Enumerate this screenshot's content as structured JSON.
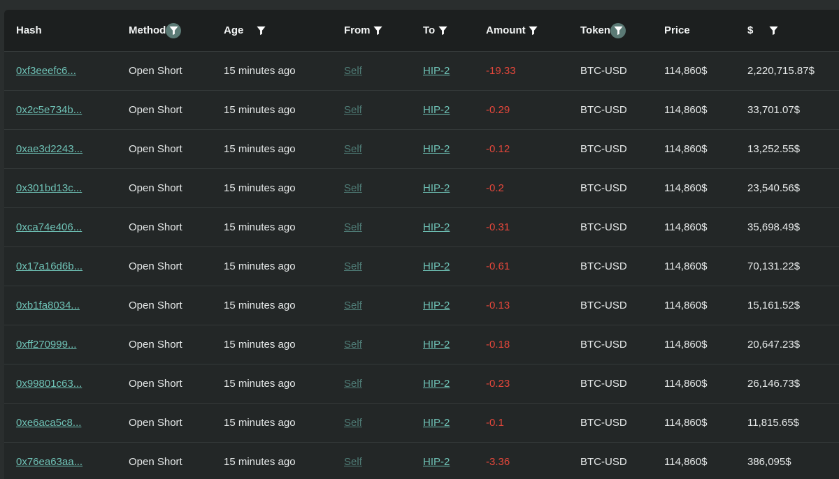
{
  "table": {
    "headers": {
      "hash": "Hash",
      "method": "Method",
      "age": "Age",
      "from": "From",
      "to": "To",
      "amount": "Amount",
      "token": "Token",
      "price": "Price",
      "usd": "$"
    },
    "rows": [
      {
        "hash": "0xf3eeefc6...",
        "method": "Open Short",
        "age": "15 minutes ago",
        "from": "Self",
        "to": "HIP-2",
        "amount": "-19.33",
        "token": "BTC-USD",
        "price": "114,860$",
        "usd": "2,220,715.87$"
      },
      {
        "hash": "0x2c5e734b...",
        "method": "Open Short",
        "age": "15 minutes ago",
        "from": "Self",
        "to": "HIP-2",
        "amount": "-0.29",
        "token": "BTC-USD",
        "price": "114,860$",
        "usd": "33,701.07$"
      },
      {
        "hash": "0xae3d2243...",
        "method": "Open Short",
        "age": "15 minutes ago",
        "from": "Self",
        "to": "HIP-2",
        "amount": "-0.12",
        "token": "BTC-USD",
        "price": "114,860$",
        "usd": "13,252.55$"
      },
      {
        "hash": "0x301bd13c...",
        "method": "Open Short",
        "age": "15 minutes ago",
        "from": "Self",
        "to": "HIP-2",
        "amount": "-0.2",
        "token": "BTC-USD",
        "price": "114,860$",
        "usd": "23,540.56$"
      },
      {
        "hash": "0xca74e406...",
        "method": "Open Short",
        "age": "15 minutes ago",
        "from": "Self",
        "to": "HIP-2",
        "amount": "-0.31",
        "token": "BTC-USD",
        "price": "114,860$",
        "usd": "35,698.49$"
      },
      {
        "hash": "0x17a16d6b...",
        "method": "Open Short",
        "age": "15 minutes ago",
        "from": "Self",
        "to": "HIP-2",
        "amount": "-0.61",
        "token": "BTC-USD",
        "price": "114,860$",
        "usd": "70,131.22$"
      },
      {
        "hash": "0xb1fa8034...",
        "method": "Open Short",
        "age": "15 minutes ago",
        "from": "Self",
        "to": "HIP-2",
        "amount": "-0.13",
        "token": "BTC-USD",
        "price": "114,860$",
        "usd": "15,161.52$"
      },
      {
        "hash": "0xff270999...",
        "method": "Open Short",
        "age": "15 minutes ago",
        "from": "Self",
        "to": "HIP-2",
        "amount": "-0.18",
        "token": "BTC-USD",
        "price": "114,860$",
        "usd": "20,647.23$"
      },
      {
        "hash": "0x99801c63...",
        "method": "Open Short",
        "age": "15 minutes ago",
        "from": "Self",
        "to": "HIP-2",
        "amount": "-0.23",
        "token": "BTC-USD",
        "price": "114,860$",
        "usd": "26,146.73$"
      },
      {
        "hash": "0xe6aca5c8...",
        "method": "Open Short",
        "age": "15 minutes ago",
        "from": "Self",
        "to": "HIP-2",
        "amount": "-0.1",
        "token": "BTC-USD",
        "price": "114,860$",
        "usd": "11,815.65$"
      },
      {
        "hash": "0x76ea63aa...",
        "method": "Open Short",
        "age": "15 minutes ago",
        "from": "Self",
        "to": "HIP-2",
        "amount": "-3.36",
        "token": "BTC-USD",
        "price": "114,860$",
        "usd": "386,095$"
      }
    ]
  },
  "filters": {
    "method": {
      "icon": "filter-icon",
      "active": true
    },
    "age": {
      "icon": "filter-icon",
      "active": false
    },
    "from": {
      "icon": "filter-icon",
      "active": false
    },
    "to": {
      "icon": "filter-icon",
      "active": false
    },
    "amount": {
      "icon": "filter-icon",
      "active": false
    },
    "token": {
      "icon": "filter-icon",
      "active": true
    },
    "usd": {
      "icon": "filter-icon",
      "active": false
    }
  },
  "colors": {
    "link": "#6ec1b5",
    "link_muted": "#4f7c76",
    "negative": "#e5473b",
    "active_filter": "#5b7a75",
    "header_bg": "#1c1f1f",
    "body_bg": "#232727"
  }
}
